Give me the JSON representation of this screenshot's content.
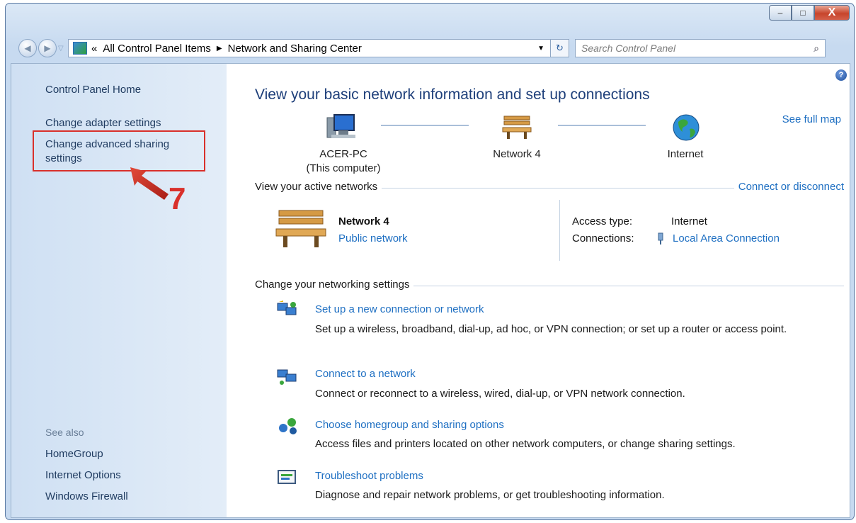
{
  "window": {
    "minimize_glyph": "–",
    "maximize_glyph": "□",
    "close_glyph": "X"
  },
  "address": {
    "chevron": "«",
    "crumb1": "All Control Panel Items",
    "crumb2": "Network and Sharing Center",
    "search_placeholder": "Search Control Panel"
  },
  "sidebar": {
    "home": "Control Panel Home",
    "items": [
      {
        "label": "Change adapter settings"
      },
      {
        "label": "Change advanced sharing settings"
      }
    ],
    "annotation_number": "7",
    "see_also": "See also",
    "see_also_items": [
      {
        "label": "HomeGroup"
      },
      {
        "label": "Internet Options"
      },
      {
        "label": "Windows Firewall"
      }
    ]
  },
  "main": {
    "title": "View your basic network information and set up connections",
    "see_full_map": "See full map",
    "map": {
      "computer_name": "ACER-PC",
      "computer_sub": "(This computer)",
      "network": "Network  4",
      "internet": "Internet"
    },
    "active_networks": {
      "label": "View your active networks",
      "connect_link": "Connect or disconnect",
      "network_name": "Network  4",
      "network_type": "Public network",
      "access_type_label": "Access type:",
      "access_type_value": "Internet",
      "connections_label": "Connections:",
      "connections_value": "Local Area Connection"
    },
    "settings": {
      "label": "Change your networking settings",
      "items": [
        {
          "title": "Set up a new connection or network",
          "desc": "Set up a wireless, broadband, dial-up, ad hoc, or VPN connection; or set up a router or access point."
        },
        {
          "title": "Connect to a network",
          "desc": "Connect or reconnect to a wireless, wired, dial-up, or VPN network connection."
        },
        {
          "title": "Choose homegroup and sharing options",
          "desc": "Access files and printers located on other network computers, or change sharing settings."
        },
        {
          "title": "Troubleshoot problems",
          "desc": "Diagnose and repair network problems, or get troubleshooting information."
        }
      ]
    }
  },
  "colors": {
    "highlight": "#d9302b",
    "link": "#1e6fc2"
  }
}
